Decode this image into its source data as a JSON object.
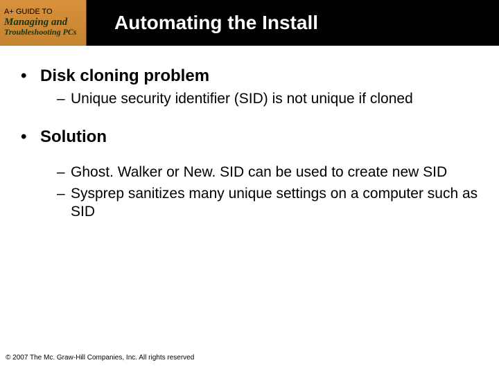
{
  "logo": {
    "line1": "A+ GUIDE TO",
    "line2": "Managing and",
    "line3": "Troubleshooting PCs"
  },
  "title": "Automating the Install",
  "bullets": [
    {
      "label": "Disk cloning problem",
      "subs": [
        "Unique security identifier (SID) is not unique if cloned"
      ]
    },
    {
      "label": "Solution",
      "subs": [
        "Ghost. Walker or New. SID can be used to create new SID",
        "Sysprep sanitizes many unique settings on a computer such as SID"
      ]
    }
  ],
  "footer": "© 2007 The Mc. Graw-Hill Companies, Inc. All rights reserved"
}
